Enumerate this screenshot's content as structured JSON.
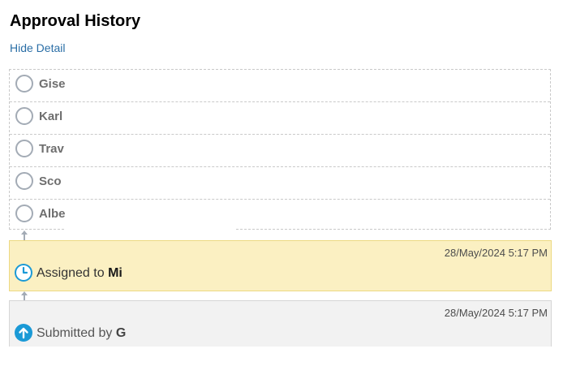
{
  "header": {
    "title": "Approval History",
    "toggle_detail_label": "Hide Detail"
  },
  "approvers": [
    {
      "name": "Gise",
      "status": "pending"
    },
    {
      "name": "Karl",
      "status": "pending"
    },
    {
      "name": "Trav",
      "status": "pending"
    },
    {
      "name": "Sco",
      "status": "pending"
    },
    {
      "name": "Albe",
      "status": "pending"
    }
  ],
  "history": [
    {
      "kind": "assigned",
      "timestamp": "28/May/2024 5:17 PM",
      "action_label": "Assigned to",
      "actor": "Mi",
      "icon": "clock-icon",
      "background": "#fbf0c2"
    },
    {
      "kind": "submitted",
      "timestamp": "28/May/2024 5:17 PM",
      "action_label": "Submitted by",
      "actor": "G",
      "icon": "arrow-up-icon",
      "background": "#f2f2f2"
    }
  ],
  "colors": {
    "link": "#2a6ea6",
    "status_icon": "#1b9ad6",
    "pending_circle": "#a3abb5"
  }
}
